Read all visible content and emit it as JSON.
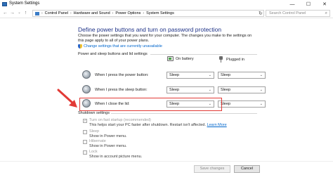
{
  "window": {
    "title": "System Settings",
    "controls": {
      "minimize": "—",
      "maximize": "☐",
      "close": "✕"
    }
  },
  "address_bar": {
    "nav": {
      "back": "←",
      "forward": "→",
      "up_dropdown": "⌄",
      "up": "↑"
    },
    "breadcrumbs": [
      "Control Panel",
      "Hardware and Sound",
      "Power Options",
      "System Settings"
    ],
    "separator": "›",
    "dropdown": "⌄",
    "refresh": "↻",
    "search_placeholder": "Search Control Panel",
    "search_icon": "⌕"
  },
  "page": {
    "heading": "Define power buttons and turn on password protection",
    "intro": "Choose the power settings that you want for your computer. The changes you make to the settings on this page apply to all of your power plans.",
    "change_link": "Change settings that are currently unavailable"
  },
  "power_buttons": {
    "section_title": "Power and sleep buttons and lid settings",
    "col_battery": "On battery",
    "col_plugged": "Plugged in",
    "caret": "⌄",
    "rows": [
      {
        "label": "When I press the power button:",
        "battery": "Sleep",
        "plugged": "Sleep"
      },
      {
        "label": "When I press the sleep button:",
        "battery": "Sleep",
        "plugged": "Sleep"
      },
      {
        "label": "When I close the lid:",
        "battery": "Sleep",
        "plugged": "Sleep"
      }
    ]
  },
  "shutdown": {
    "section_title": "Shutdown settings",
    "items": [
      {
        "label": "Turn on fast startup (recommended)",
        "desc": "This helps start your PC faster after shutdown. Restart isn't affected.",
        "link": "Learn More",
        "checked": true
      },
      {
        "label": "Sleep",
        "desc": "Show in Power menu.",
        "checked": false
      },
      {
        "label": "Hibernate",
        "desc": "Show in Power menu.",
        "checked": false
      },
      {
        "label": "Lock",
        "desc": "Show in account picture menu.",
        "checked": false
      }
    ]
  },
  "footer": {
    "save_label": "Save changes",
    "cancel_label": "Cancel"
  },
  "colors": {
    "heading": "#1e3287",
    "link": "#0066cc",
    "annotation_red": "#e23a36"
  }
}
